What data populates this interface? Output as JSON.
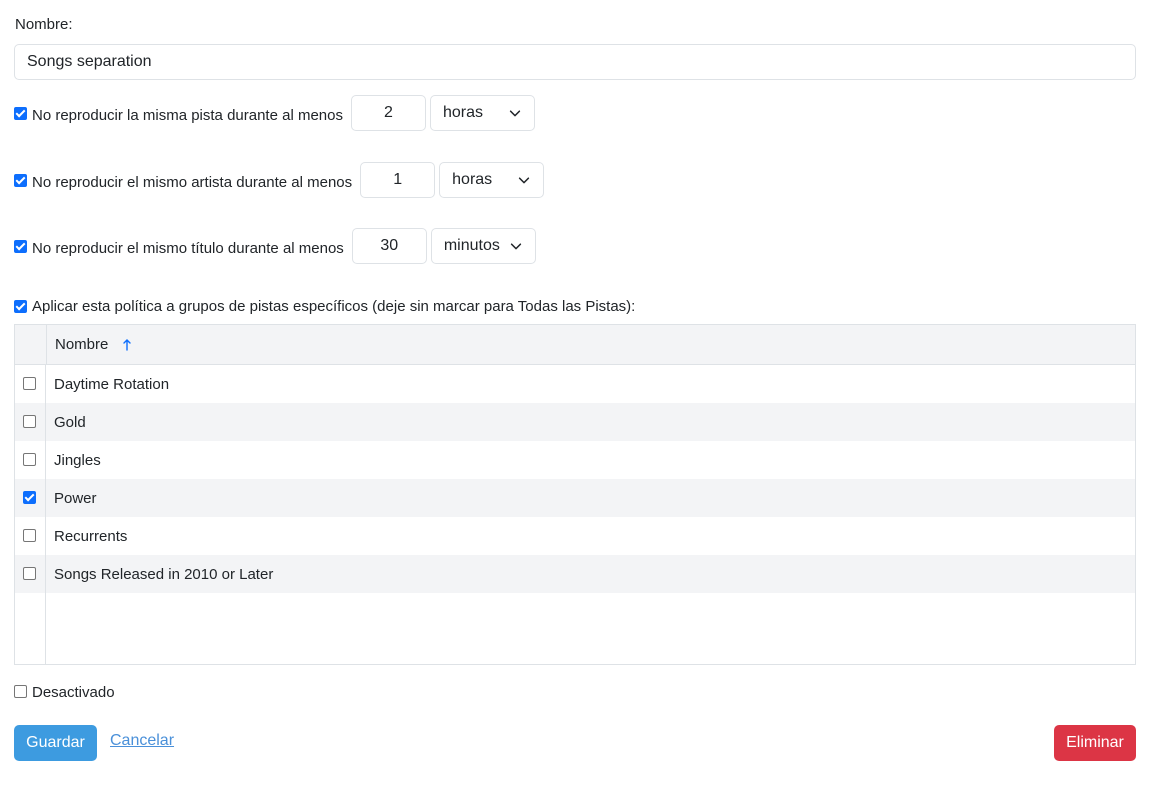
{
  "form": {
    "name_label": "Nombre:",
    "name_value": "Songs separation"
  },
  "rules": [
    {
      "checked": true,
      "label": "No reproducir la misma pista durante al menos",
      "value": "2",
      "unit": "horas"
    },
    {
      "checked": true,
      "label": "No reproducir el mismo artista durante al menos",
      "value": "1",
      "unit": "horas"
    },
    {
      "checked": true,
      "label": "No reproducir el mismo título durante al menos",
      "value": "30",
      "unit": "minutos"
    }
  ],
  "apply_groups": {
    "checked": true,
    "label": "Aplicar esta política a grupos de pistas específicos (deje sin marcar para Todas las Pistas):"
  },
  "table": {
    "header": {
      "name": "Nombre",
      "sort": "ascending"
    },
    "rows": [
      {
        "checked": false,
        "name": "Daytime Rotation"
      },
      {
        "checked": false,
        "name": "Gold"
      },
      {
        "checked": false,
        "name": "Jingles"
      },
      {
        "checked": true,
        "name": "Power"
      },
      {
        "checked": false,
        "name": "Recurrents"
      },
      {
        "checked": false,
        "name": "Songs Released in 2010 or Later"
      }
    ]
  },
  "disabled": {
    "checked": false,
    "label": "Desactivado"
  },
  "actions": {
    "save_label": "Guardar",
    "cancel_label": "Cancelar",
    "delete_label": "Eliminar"
  },
  "colors": {
    "primary": "#3d9be0",
    "checkbox": "#0d6efd",
    "danger": "#dc3545",
    "link": "#4a90d9"
  }
}
